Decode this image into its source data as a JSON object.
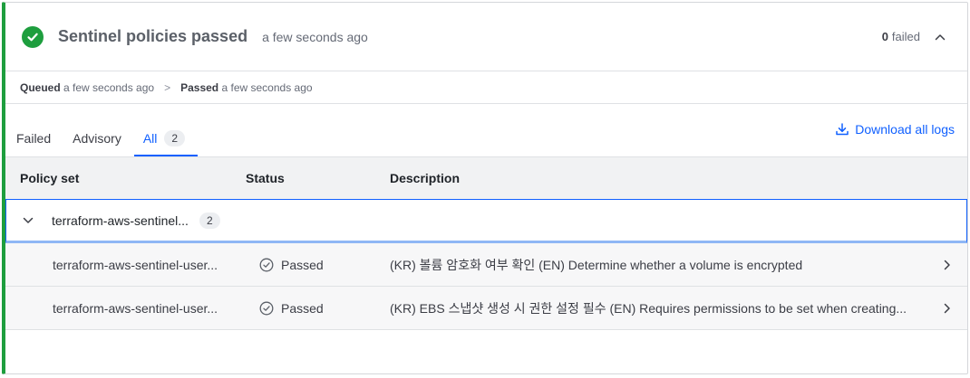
{
  "header": {
    "title": "Sentinel policies passed",
    "time": "a few seconds ago",
    "failed_count": "0",
    "failed_label": "failed"
  },
  "timeline": {
    "queued_label": "Queued",
    "queued_time": "a few seconds ago",
    "separator": ">",
    "passed_label": "Passed",
    "passed_time": "a few seconds ago"
  },
  "tabs": [
    {
      "label": "Failed"
    },
    {
      "label": "Advisory"
    },
    {
      "label": "All",
      "count": "2",
      "active": true
    }
  ],
  "download_label": "Download all logs",
  "table": {
    "columns": [
      "Policy set",
      "Status",
      "Description"
    ],
    "group": {
      "name": "terraform-aws-sentinel...",
      "count": "2"
    },
    "rows": [
      {
        "policy": "terraform-aws-sentinel-user...",
        "status": "Passed",
        "description": "(KR) 볼륨 암호화 여부 확인 (EN) Determine whether a volume is encrypted"
      },
      {
        "policy": "terraform-aws-sentinel-user...",
        "status": "Passed",
        "description": "(KR) EBS 스냅샷 생성 시 권한 설정 필수 (EN) Requires permissions to be set when creating..."
      }
    ]
  },
  "colors": {
    "accent": "#1060ff",
    "success": "#1e9e3e"
  },
  "icons": {
    "header": "check-circle-icon",
    "collapse": "chevron-up-icon",
    "download": "download-icon",
    "group": "chevron-down-icon",
    "status": "check-circle-outline-icon",
    "row": "chevron-right-icon"
  }
}
